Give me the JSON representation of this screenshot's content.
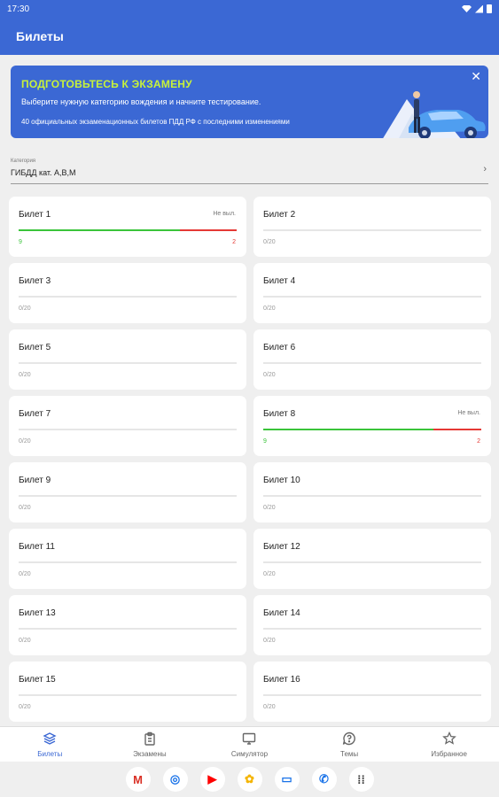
{
  "status": {
    "time": "17:30"
  },
  "appbar": {
    "title": "Билеты"
  },
  "banner": {
    "title": "ПОДГОТОВЬТЕСЬ К ЭКЗАМЕНУ",
    "text1": "Выберите нужную категорию вождения и начните тестирование.",
    "text2": "40 официальных экзаменационных билетов ПДД РФ с последними изменениями",
    "close": "✕"
  },
  "category": {
    "label": "Категория",
    "value": "ГИБДД кат. A,B,M",
    "chevron": "›"
  },
  "tickets": [
    {
      "title": "Билет 1",
      "status": "Не выл.",
      "correct": "9",
      "wrong": "2",
      "progress": "",
      "ok_fraction": 0.74,
      "bad_fraction": 0.26
    },
    {
      "title": "Билет 2",
      "status": "",
      "correct": "",
      "wrong": "",
      "progress": "0/20",
      "ok_fraction": 0,
      "bad_fraction": 0
    },
    {
      "title": "Билет 3",
      "status": "",
      "correct": "",
      "wrong": "",
      "progress": "0/20",
      "ok_fraction": 0,
      "bad_fraction": 0
    },
    {
      "title": "Билет 4",
      "status": "",
      "correct": "",
      "wrong": "",
      "progress": "0/20",
      "ok_fraction": 0,
      "bad_fraction": 0
    },
    {
      "title": "Билет 5",
      "status": "",
      "correct": "",
      "wrong": "",
      "progress": "0/20",
      "ok_fraction": 0,
      "bad_fraction": 0
    },
    {
      "title": "Билет 6",
      "status": "",
      "correct": "",
      "wrong": "",
      "progress": "0/20",
      "ok_fraction": 0,
      "bad_fraction": 0
    },
    {
      "title": "Билет 7",
      "status": "",
      "correct": "",
      "wrong": "",
      "progress": "0/20",
      "ok_fraction": 0,
      "bad_fraction": 0
    },
    {
      "title": "Билет 8",
      "status": "Не выл.",
      "correct": "9",
      "wrong": "2",
      "progress": "",
      "ok_fraction": 0.78,
      "bad_fraction": 0.22
    },
    {
      "title": "Билет 9",
      "status": "",
      "correct": "",
      "wrong": "",
      "progress": "0/20",
      "ok_fraction": 0,
      "bad_fraction": 0
    },
    {
      "title": "Билет 10",
      "status": "",
      "correct": "",
      "wrong": "",
      "progress": "0/20",
      "ok_fraction": 0,
      "bad_fraction": 0
    },
    {
      "title": "Билет 11",
      "status": "",
      "correct": "",
      "wrong": "",
      "progress": "0/20",
      "ok_fraction": 0,
      "bad_fraction": 0
    },
    {
      "title": "Билет 12",
      "status": "",
      "correct": "",
      "wrong": "",
      "progress": "0/20",
      "ok_fraction": 0,
      "bad_fraction": 0
    },
    {
      "title": "Билет 13",
      "status": "",
      "correct": "",
      "wrong": "",
      "progress": "0/20",
      "ok_fraction": 0,
      "bad_fraction": 0
    },
    {
      "title": "Билет 14",
      "status": "",
      "correct": "",
      "wrong": "",
      "progress": "0/20",
      "ok_fraction": 0,
      "bad_fraction": 0
    },
    {
      "title": "Билет 15",
      "status": "",
      "correct": "",
      "wrong": "",
      "progress": "0/20",
      "ok_fraction": 0,
      "bad_fraction": 0
    },
    {
      "title": "Билет 16",
      "status": "",
      "correct": "",
      "wrong": "",
      "progress": "0/20",
      "ok_fraction": 0,
      "bad_fraction": 0
    }
  ],
  "nav": [
    {
      "label": "Билеты",
      "icon": "layers-icon",
      "active": true
    },
    {
      "label": "Экзамены",
      "icon": "clipboard-icon",
      "active": false
    },
    {
      "label": "Симулятор",
      "icon": "monitor-icon",
      "active": false
    },
    {
      "label": "Темы",
      "icon": "help-bubble-icon",
      "active": false
    },
    {
      "label": "Избранное",
      "icon": "star-icon",
      "active": false
    }
  ],
  "dock": [
    {
      "icon": "gmail-icon",
      "glyph": "M",
      "color": "#d93025"
    },
    {
      "icon": "chrome-icon",
      "glyph": "◎",
      "color": "#1a73e8"
    },
    {
      "icon": "youtube-icon",
      "glyph": "▶",
      "color": "#ff0000"
    },
    {
      "icon": "photos-icon",
      "glyph": "✿",
      "color": "#f4b400"
    },
    {
      "icon": "messages-icon",
      "glyph": "▭",
      "color": "#1a73e8"
    },
    {
      "icon": "phone-icon",
      "glyph": "✆",
      "color": "#1a73e8"
    },
    {
      "icon": "app-drawer-icon",
      "glyph": "⁞⁞",
      "color": "#333333"
    }
  ],
  "colors": {
    "primary": "#3b68d4",
    "accent": "#c8f23a",
    "correct": "#3ac43a",
    "wrong": "#e53935"
  }
}
